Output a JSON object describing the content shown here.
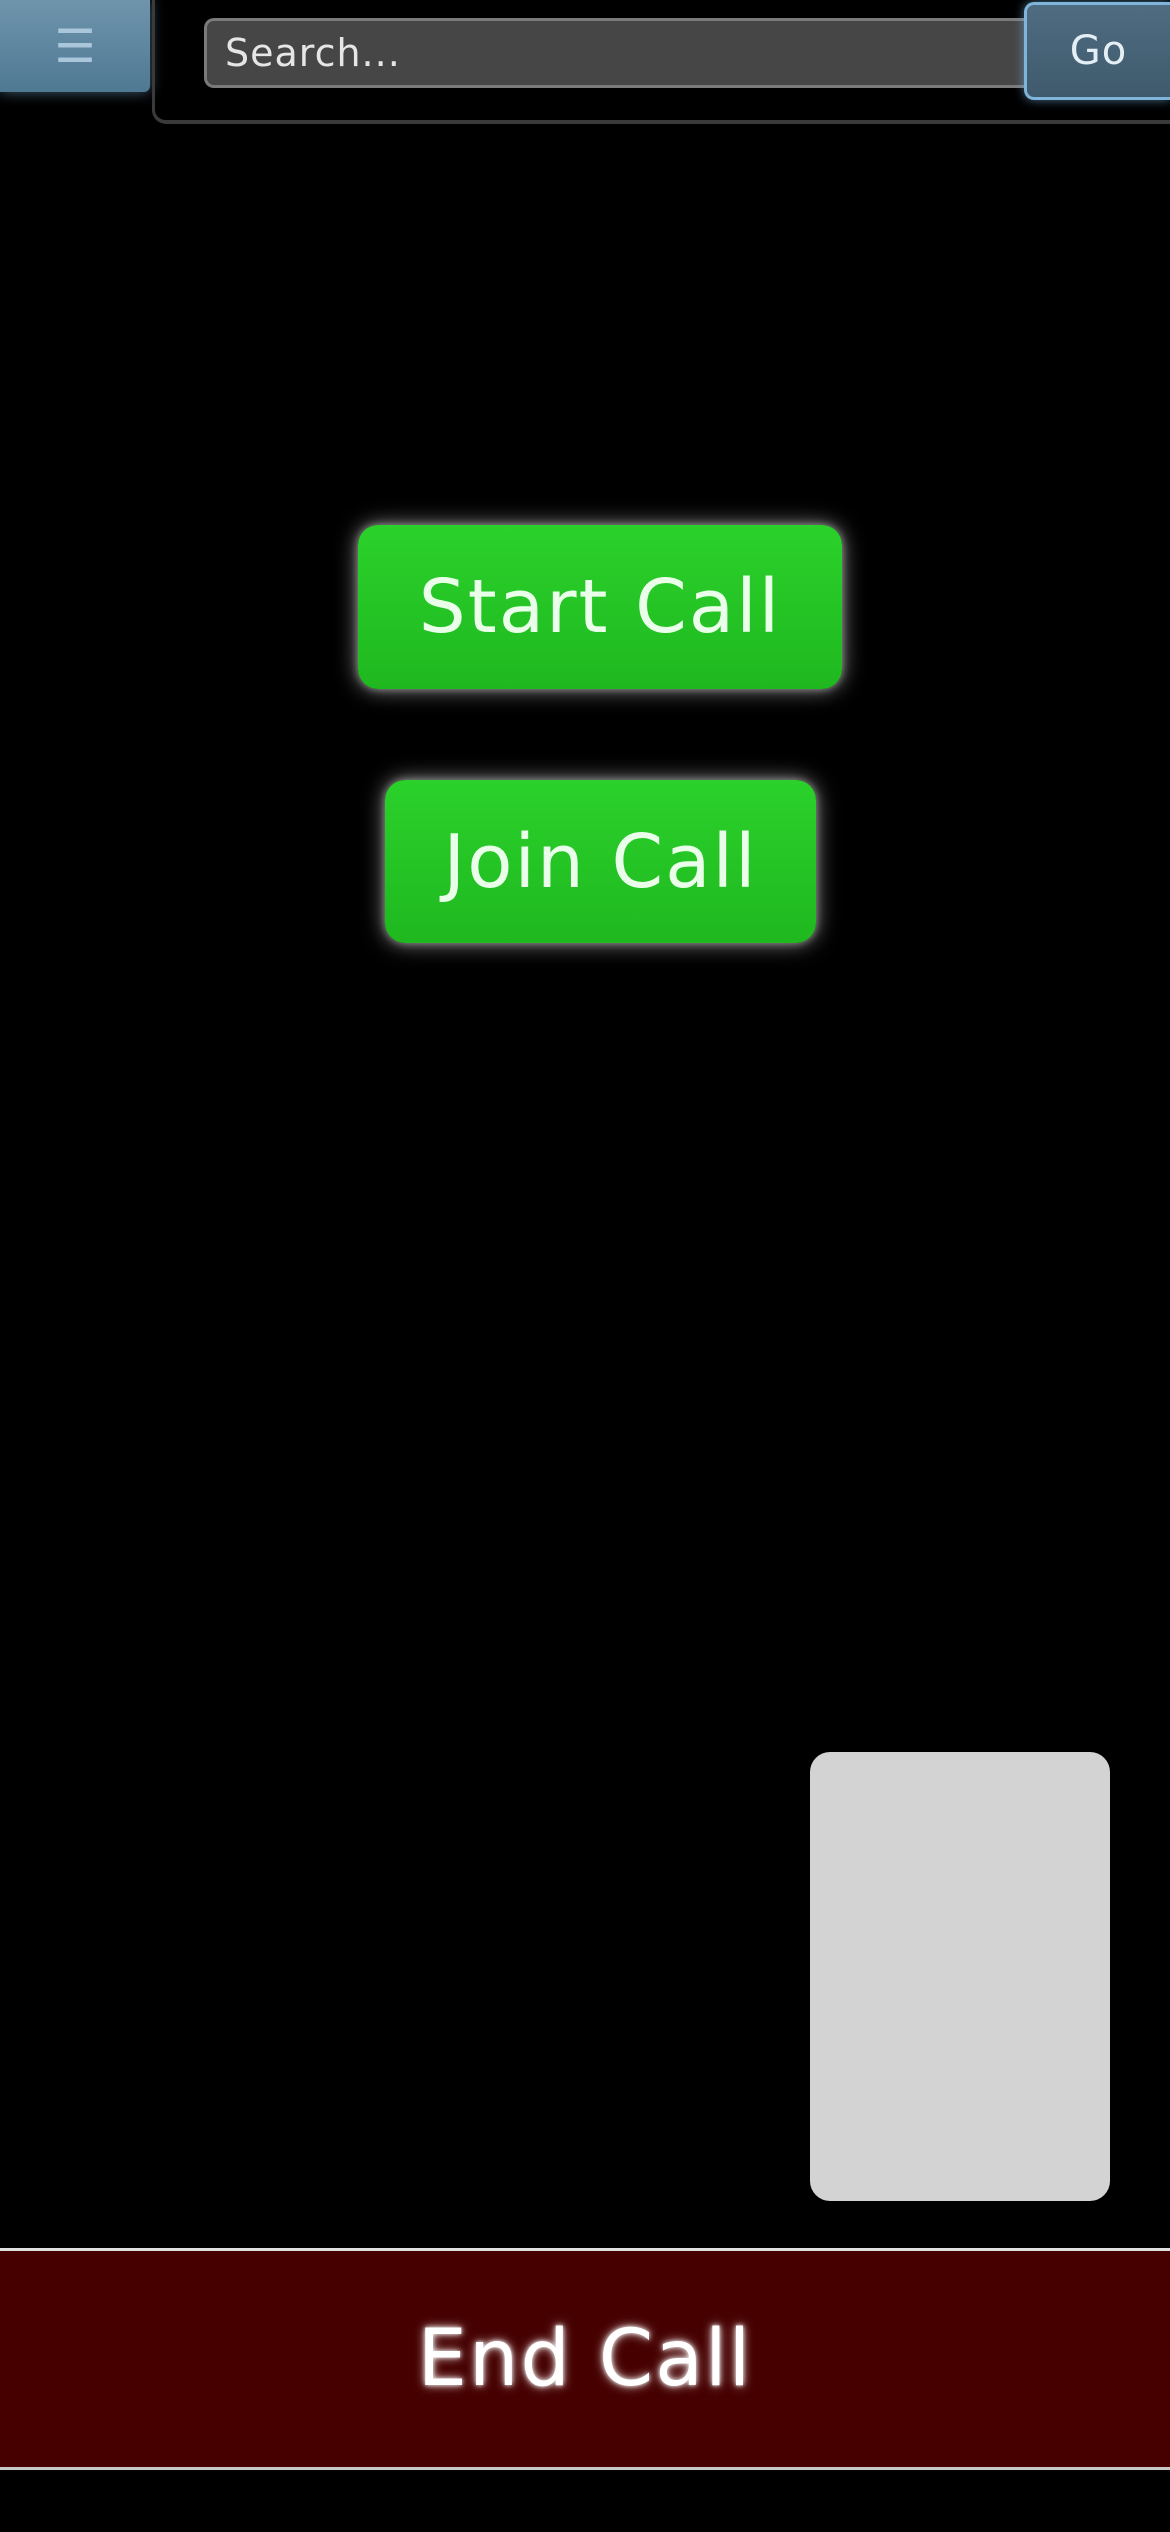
{
  "header": {
    "menu_icon": "hamburger-icon",
    "menu_glyph": "☰",
    "search_placeholder": "Search...",
    "search_value": "",
    "go_label": "Go"
  },
  "main": {
    "start_call_label": "Start Call",
    "join_call_label": "Join Call"
  },
  "footer": {
    "end_call_label": "End Call"
  },
  "colors": {
    "background": "#000000",
    "call_button": "#1fbf1f",
    "end_call_bar": "#460000",
    "self_view": "#d3d3d3",
    "menu_button": "#5f88a3",
    "go_button": "#46637a"
  }
}
